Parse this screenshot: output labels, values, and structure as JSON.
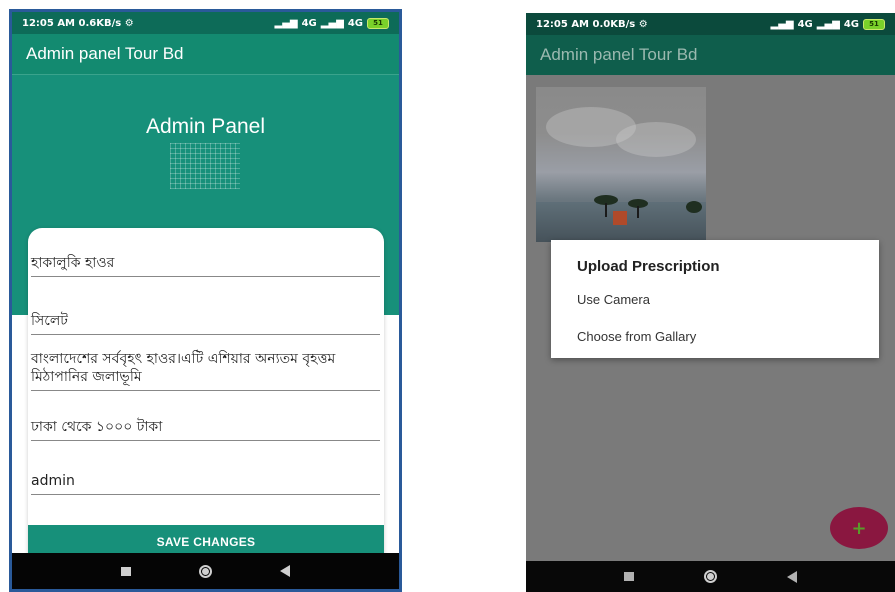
{
  "left_phone": {
    "status": {
      "time": "12:05 AM",
      "speed": "0.6KB/s",
      "network": "4G",
      "network2": "4G",
      "battery": "51"
    },
    "app_title": "Admin panel Tour Bd",
    "panel_title": "Admin Panel",
    "fields": {
      "name": "হাকালুকি হাওর",
      "location": "সিলেট",
      "description": "বাংলাদেশের সর্ববৃহৎ হাওর।এটি এশিয়ার অন্যতম বৃহত্তম মিঠাপানির জলাভূমি",
      "cost": "ঢাকা থেকে ১০০০ টাকা",
      "admin": "admin"
    },
    "save_label": "SAVE CHANGES"
  },
  "right_phone": {
    "status": {
      "time": "12:05 AM",
      "speed": "0.0KB/s",
      "network": "4G",
      "network2": "4G",
      "battery": "51"
    },
    "app_title": "Admin panel Tour Bd",
    "dialog": {
      "title": "Upload Prescription",
      "option_camera": "Use Camera",
      "option_gallery": "Choose from Gallary"
    },
    "fab_label": "+"
  },
  "colors": {
    "primary": "#17907a",
    "primary_dark": "#0d6b58",
    "fab": "#8a1740"
  }
}
